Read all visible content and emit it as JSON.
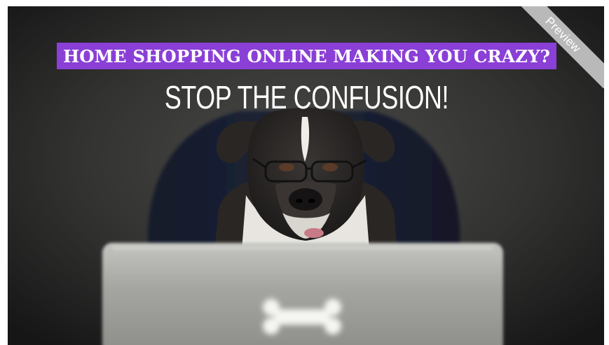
{
  "ad": {
    "headline": "HOME SHOPPING ONLINE MAKING YOU CRAZY?",
    "subheadline": "STOP THE CONFUSION!"
  },
  "ribbon": {
    "label": "Preview"
  },
  "scene": {
    "subject": "dog-with-glasses-icon",
    "laptop_logo": "bone-icon",
    "colors": {
      "background": "#2c2c2c",
      "headline_bar": "#8a3fd6",
      "laptop": "#a9aaa5",
      "ribbon": "#b9b9b9"
    }
  }
}
